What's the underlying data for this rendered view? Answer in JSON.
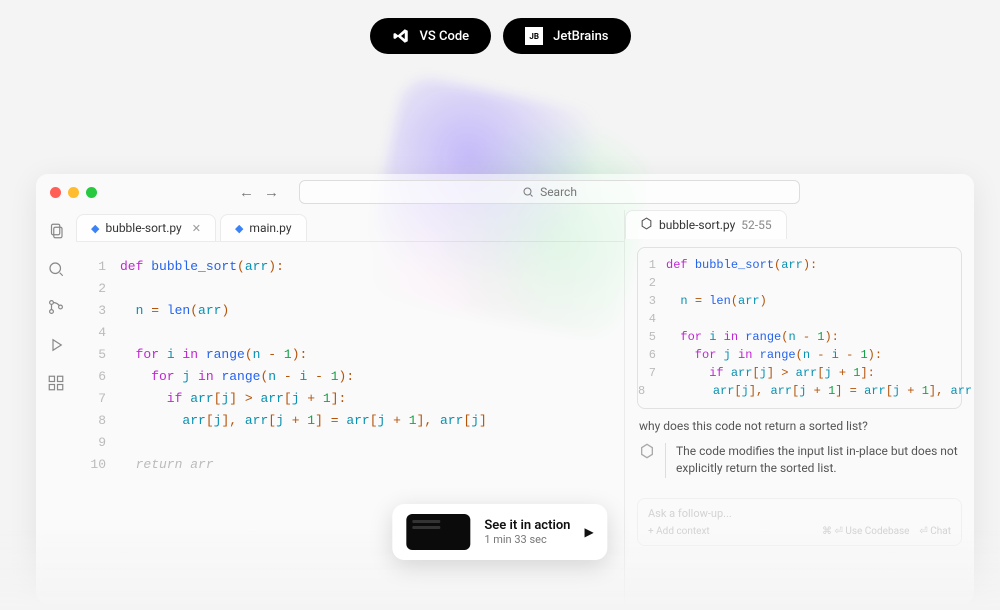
{
  "ide_buttons": [
    {
      "label": "VS Code",
      "icon": "vscode-icon"
    },
    {
      "label": "JetBrains",
      "icon": "jetbrains-icon"
    }
  ],
  "window": {
    "search_placeholder": "Search",
    "tabs": [
      {
        "label": "bubble-sort.py",
        "closable": true
      },
      {
        "label": "main.py",
        "closable": false
      }
    ],
    "code": {
      "lines": [
        [
          {
            "t": "def ",
            "c": "kw"
          },
          {
            "t": "bubble_sort",
            "c": "fn-name"
          },
          {
            "t": "(",
            "c": "punc"
          },
          {
            "t": "arr",
            "c": "param"
          },
          {
            "t": "):",
            "c": "punc"
          }
        ],
        [],
        [
          {
            "t": "  n ",
            "c": "ident"
          },
          {
            "t": "= ",
            "c": "punc"
          },
          {
            "t": "len",
            "c": "fn-call"
          },
          {
            "t": "(",
            "c": "punc"
          },
          {
            "t": "arr",
            "c": "ident"
          },
          {
            "t": ")",
            "c": "punc"
          }
        ],
        [],
        [
          {
            "t": "  for ",
            "c": "kw"
          },
          {
            "t": "i ",
            "c": "ident"
          },
          {
            "t": "in ",
            "c": "kw"
          },
          {
            "t": "range",
            "c": "fn-call"
          },
          {
            "t": "(",
            "c": "punc"
          },
          {
            "t": "n ",
            "c": "ident"
          },
          {
            "t": "- ",
            "c": "punc"
          },
          {
            "t": "1",
            "c": "num"
          },
          {
            "t": "):",
            "c": "punc"
          }
        ],
        [
          {
            "t": "    for ",
            "c": "kw"
          },
          {
            "t": "j ",
            "c": "ident"
          },
          {
            "t": "in ",
            "c": "kw"
          },
          {
            "t": "range",
            "c": "fn-call"
          },
          {
            "t": "(",
            "c": "punc"
          },
          {
            "t": "n ",
            "c": "ident"
          },
          {
            "t": "- ",
            "c": "punc"
          },
          {
            "t": "i ",
            "c": "ident"
          },
          {
            "t": "- ",
            "c": "punc"
          },
          {
            "t": "1",
            "c": "num"
          },
          {
            "t": "):",
            "c": "punc"
          }
        ],
        [
          {
            "t": "      if ",
            "c": "kw"
          },
          {
            "t": "arr",
            "c": "ident"
          },
          {
            "t": "[",
            "c": "punc"
          },
          {
            "t": "j",
            "c": "ident"
          },
          {
            "t": "] > ",
            "c": "punc"
          },
          {
            "t": "arr",
            "c": "ident"
          },
          {
            "t": "[",
            "c": "punc"
          },
          {
            "t": "j ",
            "c": "ident"
          },
          {
            "t": "+ ",
            "c": "punc"
          },
          {
            "t": "1",
            "c": "num"
          },
          {
            "t": "]:",
            "c": "punc"
          }
        ],
        [
          {
            "t": "        arr",
            "c": "ident"
          },
          {
            "t": "[",
            "c": "punc"
          },
          {
            "t": "j",
            "c": "ident"
          },
          {
            "t": "], ",
            "c": "punc"
          },
          {
            "t": "arr",
            "c": "ident"
          },
          {
            "t": "[",
            "c": "punc"
          },
          {
            "t": "j ",
            "c": "ident"
          },
          {
            "t": "+ ",
            "c": "punc"
          },
          {
            "t": "1",
            "c": "num"
          },
          {
            "t": "] = ",
            "c": "punc"
          },
          {
            "t": "arr",
            "c": "ident"
          },
          {
            "t": "[",
            "c": "punc"
          },
          {
            "t": "j ",
            "c": "ident"
          },
          {
            "t": "+ ",
            "c": "punc"
          },
          {
            "t": "1",
            "c": "num"
          },
          {
            "t": "], ",
            "c": "punc"
          },
          {
            "t": "arr",
            "c": "ident"
          },
          {
            "t": "[",
            "c": "punc"
          },
          {
            "t": "j",
            "c": "ident"
          },
          {
            "t": "]",
            "c": "punc"
          }
        ],
        [],
        [
          {
            "t": "  return arr",
            "c": "ghost"
          }
        ]
      ]
    }
  },
  "chat": {
    "tab_label": "bubble-sort.py",
    "tab_range": "52-55",
    "question": "why does this code not return a sorted list?",
    "answer": "The code modifies the input list in-place but does not explicitly return the sorted list.",
    "followup_placeholder": "Ask a follow-up...",
    "followup_hint": "+ Add context",
    "followup_right1": "⌘ ⏎ Use Codebase",
    "followup_right2": "⏎ Chat"
  },
  "action": {
    "title": "See it in action",
    "subtitle": "1 min 33 sec"
  }
}
